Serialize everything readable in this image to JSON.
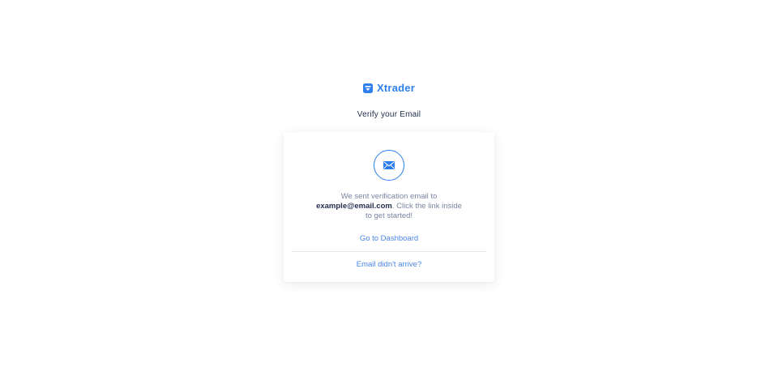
{
  "brand": {
    "name": "Xtrader",
    "icon": "xtrader-logo-icon",
    "color": "#2f80ed"
  },
  "page": {
    "title": "Verify your Email"
  },
  "card": {
    "icon": "envelope-icon",
    "message_prefix": "We sent verification email to",
    "email": "example@email.com",
    "message_suffix": ". Click the link inside to get started!",
    "dashboard_link": "Go to Dashboard",
    "resend_link": "Email didn't arrive?"
  },
  "colors": {
    "accent": "#2f80ed",
    "heading": "#1f2d4d",
    "muted": "#7b85a3"
  }
}
